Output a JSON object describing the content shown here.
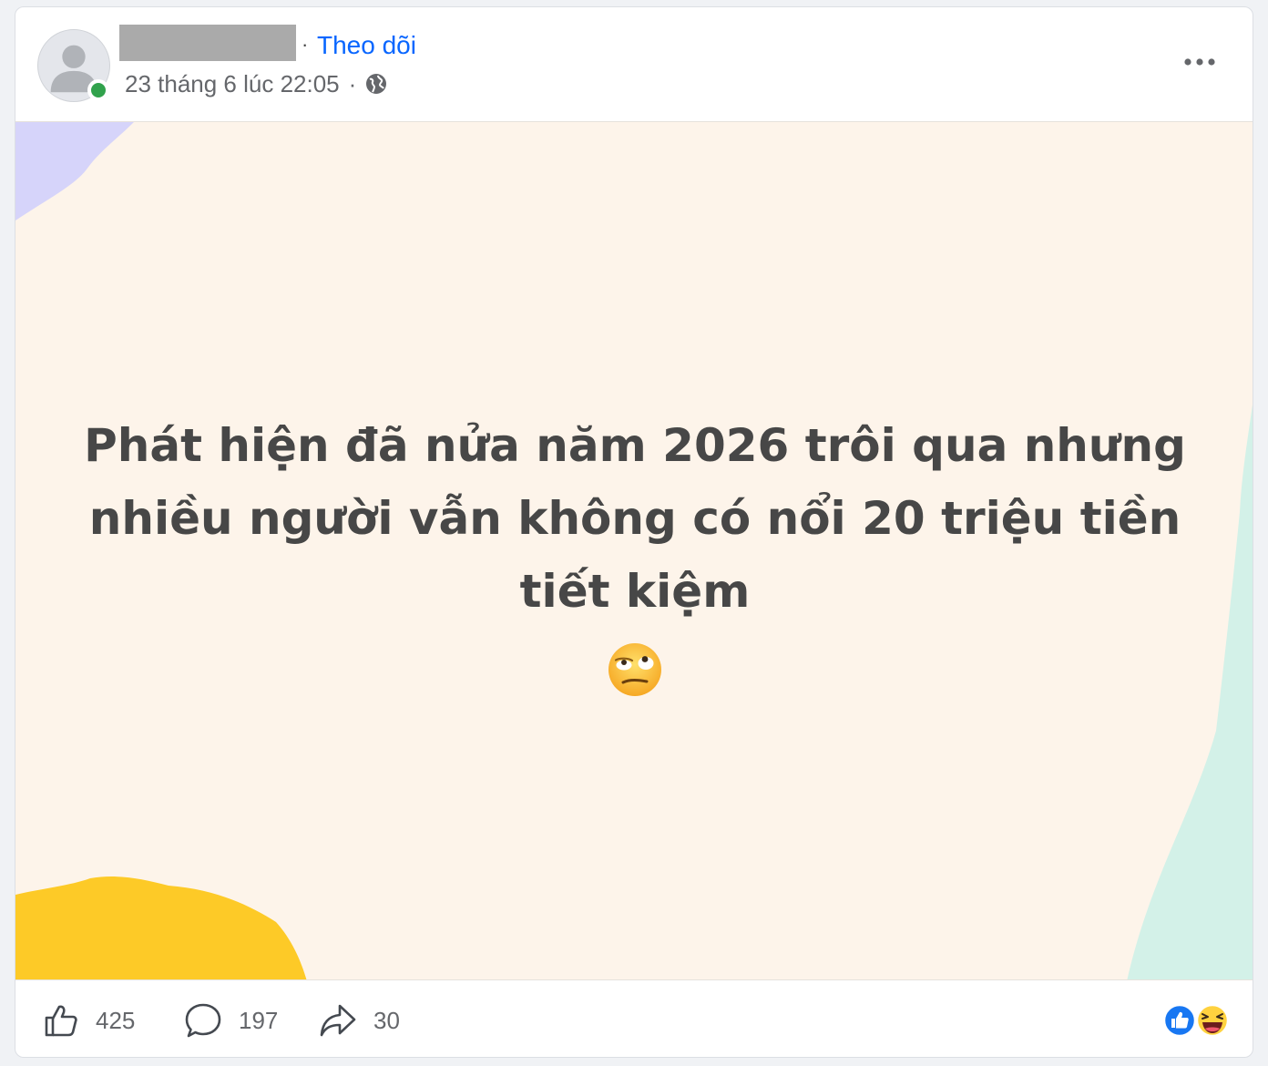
{
  "post": {
    "author_name": "",
    "follow_separator": "·",
    "follow_label": "Theo dõi",
    "timestamp": "23 tháng 6 lúc 22:05",
    "timestamp_separator": "·",
    "privacy_icon": "globe-icon",
    "more_icon": "more-horizontal-icon",
    "author_online": true,
    "text_lines": [
      "Phát hiện đã nửa năm 2026 trôi qua nhưng",
      "nhiều người vẫn không có nổi 20 triệu tiền",
      "tiết kiệm"
    ],
    "emoji": "face-with-rolling-eyes-emoji",
    "background_color": "#fdf4ea",
    "text_color": "#474747"
  },
  "footer": {
    "like": {
      "icon": "like-icon",
      "count": "425"
    },
    "comment": {
      "icon": "comment-icon",
      "count": "197"
    },
    "share": {
      "icon": "share-icon",
      "count": "30"
    },
    "reactions": [
      "like-reaction-icon",
      "haha-reaction-icon"
    ]
  },
  "colors": {
    "accent": "#0866ff",
    "online": "#31a24c",
    "muted_text": "#65676b"
  }
}
